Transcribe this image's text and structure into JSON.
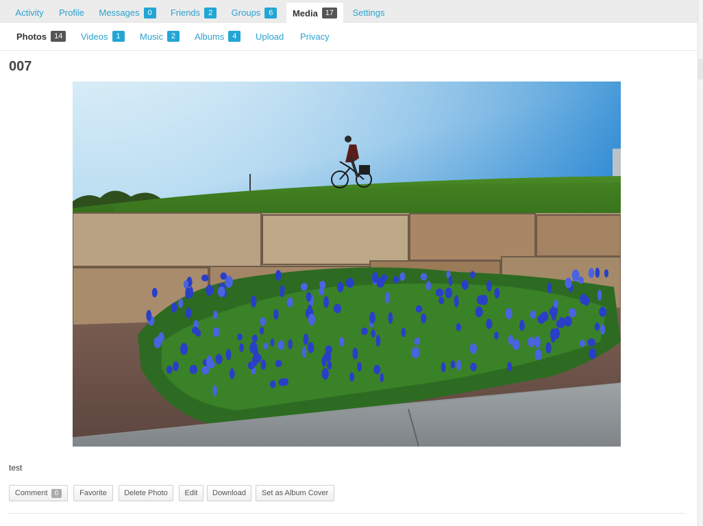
{
  "primary_nav": [
    {
      "label": "Activity",
      "count": null
    },
    {
      "label": "Profile",
      "count": null
    },
    {
      "label": "Messages",
      "count": "0"
    },
    {
      "label": "Friends",
      "count": "2"
    },
    {
      "label": "Groups",
      "count": "6"
    },
    {
      "label": "Media",
      "count": "17",
      "active": true
    },
    {
      "label": "Settings",
      "count": null
    }
  ],
  "secondary_nav": [
    {
      "label": "Photos",
      "count": "14",
      "active": true
    },
    {
      "label": "Videos",
      "count": "1"
    },
    {
      "label": "Music",
      "count": "2"
    },
    {
      "label": "Albums",
      "count": "4"
    },
    {
      "label": "Upload",
      "count": null
    },
    {
      "label": "Privacy",
      "count": null
    }
  ],
  "photo": {
    "title": "007",
    "caption": "test"
  },
  "actions": {
    "comment_label": "Comment",
    "comment_count": "0",
    "favorite_label": "Favorite",
    "delete_label": "Delete Photo",
    "edit_label": "Edit",
    "download_label": "Download",
    "album_cover_label": "Set as Album Cover"
  },
  "colors": {
    "link": "#2aa1cf",
    "badge": "#23a6d5",
    "badge_active": "#555555"
  }
}
